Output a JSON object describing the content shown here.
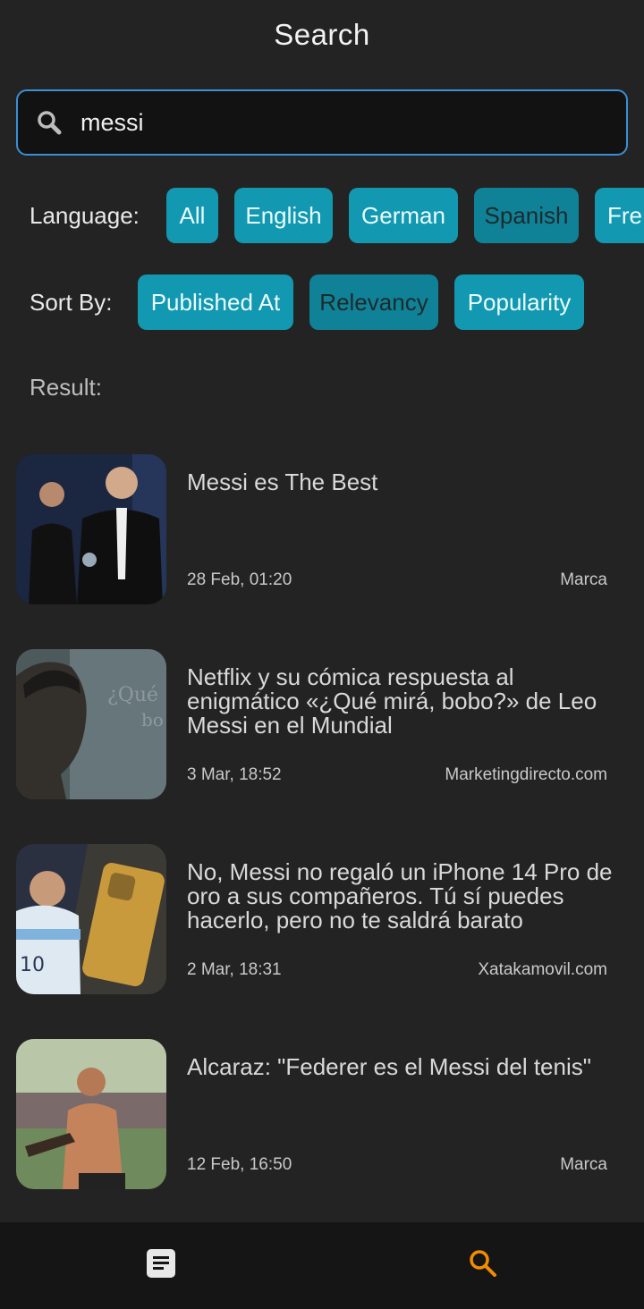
{
  "header": {
    "title": "Search"
  },
  "search": {
    "value": "messi",
    "icon": "search-icon"
  },
  "language": {
    "label": "Language:",
    "options": [
      "All",
      "English",
      "German",
      "Spanish",
      "Fre"
    ],
    "selected": "Spanish"
  },
  "sort": {
    "label": "Sort By:",
    "options": [
      "Published At",
      "Relevancy",
      "Popularity"
    ],
    "selected": "Relevancy"
  },
  "result_label": "Result:",
  "articles": [
    {
      "title": "Messi es The Best",
      "date": "28 Feb, 01:20",
      "source": "Marca"
    },
    {
      "title": "Netflix y su cómica respuesta al enigmático «¿Qué mirá, bobo?» de Leo Messi en el Mundial",
      "date": "3 Mar, 18:52",
      "source": "Marketingdirecto.com"
    },
    {
      "title": "No, Messi no regaló un iPhone 14 Pro de oro a sus compañeros. Tú sí puedes hacerlo, pero no te saldrá barato",
      "date": "2 Mar, 18:31",
      "source": "Xatakamovil.com"
    },
    {
      "title": "Alcaraz: \"Federer es el Messi del tenis\"",
      "date": "12 Feb, 16:50",
      "source": "Marca"
    }
  ],
  "bottom_nav": {
    "tabs": [
      {
        "icon": "news-list-icon",
        "active": false
      },
      {
        "icon": "search-icon",
        "active": true
      }
    ]
  },
  "colors": {
    "accent": "#1298b0",
    "active_nav": "#f28c00",
    "search_border": "#3a8fd6",
    "background": "#232323"
  }
}
